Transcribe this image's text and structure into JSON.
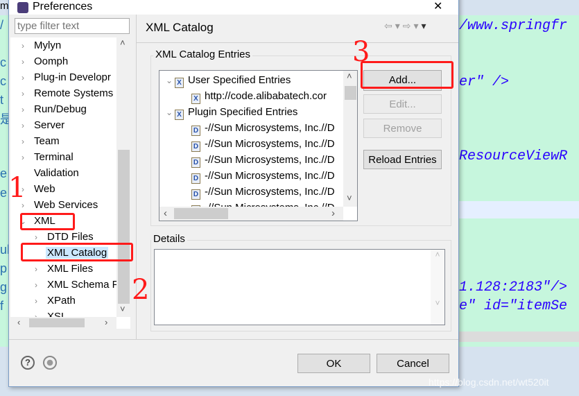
{
  "editor": {
    "lines": [
      "/www.springfr",
      "er\" />",
      "ResourceViewR",
      "1.128:2183\"/>",
      "e\" id=\"itemSe"
    ],
    "left_chars": [
      "/",
      "c",
      "c",
      "t",
      "是",
      "e",
      "e",
      "ul",
      "p",
      "g",
      "f"
    ],
    "tab_label": "ml"
  },
  "dialog": {
    "title": "Preferences",
    "filter_placeholder": "type filter text",
    "tree": [
      {
        "label": "Mylyn",
        "expanded": false
      },
      {
        "label": "Oomph",
        "expanded": false
      },
      {
        "label": "Plug-in Developr",
        "expanded": false
      },
      {
        "label": "Remote Systems",
        "expanded": false
      },
      {
        "label": "Run/Debug",
        "expanded": false
      },
      {
        "label": "Server",
        "expanded": false
      },
      {
        "label": "Team",
        "expanded": false
      },
      {
        "label": "Terminal",
        "expanded": false
      },
      {
        "label": "Validation",
        "expanded": null
      },
      {
        "label": "Web",
        "expanded": false
      },
      {
        "label": "Web Services",
        "expanded": false
      },
      {
        "label": "XML",
        "expanded": true
      },
      {
        "label": "DTD Files",
        "expanded": false
      },
      {
        "label": "XML Catalog",
        "expanded": null,
        "selected": true
      },
      {
        "label": "XML Files",
        "expanded": false
      },
      {
        "label": "XML Schema F",
        "expanded": false
      },
      {
        "label": "XPath",
        "expanded": false
      },
      {
        "label": "XSL",
        "expanded": false
      }
    ],
    "page_title": "XML Catalog",
    "entries_group": "XML Catalog Entries",
    "entries": [
      {
        "label": "User Specified Entries",
        "level": 0,
        "icon": "catalog-icon"
      },
      {
        "label": "http://code.alibabatech.cor",
        "level": 1,
        "icon": "xml-file-icon"
      },
      {
        "label": "Plugin Specified Entries",
        "level": 0,
        "icon": "catalog-icon"
      },
      {
        "label": "-//Sun Microsystems, Inc.//D",
        "level": 1,
        "icon": "dtd-file-icon"
      },
      {
        "label": "-//Sun Microsystems, Inc.//D",
        "level": 1,
        "icon": "dtd-file-icon"
      },
      {
        "label": "-//Sun Microsystems, Inc.//D",
        "level": 1,
        "icon": "dtd-file-icon"
      },
      {
        "label": "-//Sun Microsystems, Inc.//D",
        "level": 1,
        "icon": "dtd-file-icon"
      },
      {
        "label": "-//Sun Microsystems, Inc.//D",
        "level": 1,
        "icon": "dtd-file-icon"
      },
      {
        "label": "-//Sun Microsystems, Inc.//D",
        "level": 1,
        "icon": "dtd-file-icon"
      }
    ],
    "buttons": {
      "add": "Add...",
      "edit": "Edit...",
      "remove": "Remove",
      "reload": "Reload Entries",
      "ok": "OK",
      "cancel": "Cancel"
    },
    "details_group": "Details"
  },
  "annotations": {
    "one": "1",
    "two": "2",
    "three": "3"
  },
  "watermark": "https://blog.csdn.net/wt520it",
  "colors": {
    "highlight": "#ff1a1a",
    "selection": "#cce8ff",
    "editor_bg": "#c6f6dd"
  }
}
